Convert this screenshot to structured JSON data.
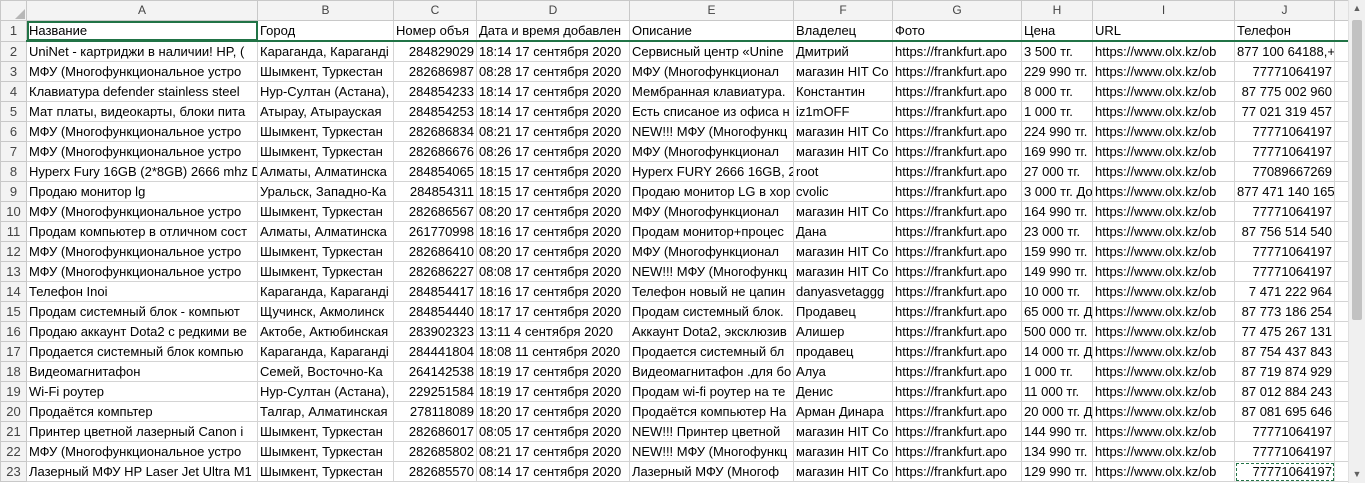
{
  "columns": [
    "A",
    "B",
    "C",
    "D",
    "E",
    "F",
    "G",
    "H",
    "I",
    "J"
  ],
  "header_row": [
    "Название",
    "Город",
    "Номер объя",
    "Дата и время добавлен",
    "Описание",
    "Владелец",
    "Фото",
    "Цена",
    "URL",
    "Телефон"
  ],
  "rows": [
    {
      "n": "2",
      "cells": [
        "UniNet - картриджи в наличии! HP, (",
        "Караганда, Караганді",
        "284829029",
        "18:14 17 сентября 2020",
        "Сервисный центр «Unine",
        "Дмитрий",
        "https://frankfurt.apo",
        "3 500 тг.",
        "https://www.olx.kz/ob",
        "877 100 64188,+7 ("
      ]
    },
    {
      "n": "3",
      "cells": [
        "МФУ (Многофункциональное устро",
        "Шымкент, Туркестан",
        "282686987",
        "08:28 17 сентября 2020",
        "МФУ (Многофункционал",
        "магазин HIT Co",
        "https://frankfurt.apo",
        "229 990 тг.",
        "https://www.olx.kz/ob",
        "77771064197"
      ]
    },
    {
      "n": "4",
      "cells": [
        "Клавиатура defender stainless steel",
        "Нур-Султан (Астана),",
        "284854233",
        "18:14 17 сентября 2020",
        "Мембранная клавиатура.",
        "Константин",
        "https://frankfurt.apo",
        "8 000 тг.",
        "https://www.olx.kz/ob",
        "87 775 002 960"
      ]
    },
    {
      "n": "5",
      "cells": [
        "Мат платы, видеокарты, блоки пита",
        "Атырау, Атырауская",
        "284854253",
        "18:14 17 сентября 2020",
        "Есть списаное из офиса н",
        "iz1mOFF",
        "https://frankfurt.apo",
        "1 000 тг.",
        "https://www.olx.kz/ob",
        "77 021 319 457"
      ]
    },
    {
      "n": "6",
      "cells": [
        "МФУ (Многофункциональное устро",
        "Шымкент, Туркестан",
        "282686834",
        "08:21 17 сентября 2020",
        "NEW!!! МФУ (Многофункц",
        "магазин HIT Co",
        "https://frankfurt.apo",
        "224 990 тг.",
        "https://www.olx.kz/ob",
        "77771064197"
      ]
    },
    {
      "n": "7",
      "cells": [
        "МФУ (Многофункциональное устро",
        "Шымкент, Туркестан",
        "282686676",
        "08:26 17 сентября 2020",
        "МФУ (Многофункционал",
        "магазин HIT Co",
        "https://frankfurt.apo",
        "169 990 тг.",
        "https://www.olx.kz/ob",
        "77771064197"
      ]
    },
    {
      "n": "8",
      "cells": [
        "Hyperx Fury 16GB (2*8GB) 2666 mhz D",
        "Алматы, Алматинска",
        "284854065",
        "18:15 17 сентября 2020",
        "Hyperx FURY 2666 16GB, 2x",
        "root",
        "https://frankfurt.apo",
        "27 000 тг.",
        "https://www.olx.kz/ob",
        "77089667269"
      ]
    },
    {
      "n": "9",
      "cells": [
        "Продаю монитор lg",
        "Уральск, Западно-Ка",
        "284854311",
        "18:15 17 сентября 2020",
        "Продаю монитор LG в хор",
        "cvolic",
        "https://frankfurt.apo",
        "3 000 тг. До",
        "https://www.olx.kz/ob",
        "877 471 140 165"
      ]
    },
    {
      "n": "10",
      "cells": [
        "МФУ (Многофункциональное устро",
        "Шымкент, Туркестан",
        "282686567",
        "08:20 17 сентября 2020",
        "МФУ (Многофункционал",
        "магазин HIT Co",
        "https://frankfurt.apo",
        "164 990 тг.",
        "https://www.olx.kz/ob",
        "77771064197"
      ]
    },
    {
      "n": "11",
      "cells": [
        "Продам компьютер в отличном сост",
        "Алматы, Алматинска",
        "261770998",
        "18:16 17 сентября 2020",
        "Продам монитор+процес",
        "Дана",
        "https://frankfurt.apo",
        "23 000 тг.",
        "https://www.olx.kz/ob",
        "87 756 514 540"
      ]
    },
    {
      "n": "12",
      "cells": [
        "МФУ (Многофункциональное устро",
        "Шымкент, Туркестан",
        "282686410",
        "08:20 17 сентября 2020",
        "МФУ (Многофункционал",
        "магазин HIT Co",
        "https://frankfurt.apo",
        "159 990 тг.",
        "https://www.olx.kz/ob",
        "77771064197"
      ]
    },
    {
      "n": "13",
      "cells": [
        "МФУ (Многофункциональное устро",
        "Шымкент, Туркестан",
        "282686227",
        "08:08 17 сентября 2020",
        "NEW!!! МФУ (Многофункц",
        "магазин HIT Co",
        "https://frankfurt.apo",
        "149 990 тг.",
        "https://www.olx.kz/ob",
        "77771064197"
      ]
    },
    {
      "n": "14",
      "cells": [
        "Телефон Inoi",
        "Караганда, Караганді",
        "284854417",
        "18:16 17 сентября 2020",
        "Телефон новый не цапин",
        "danyasvetaggg",
        "https://frankfurt.apo",
        "10 000 тг.",
        "https://www.olx.kz/ob",
        "7 471 222 964"
      ]
    },
    {
      "n": "15",
      "cells": [
        "Продам системный блок - компьют",
        "Щучинск, Акмолинск",
        "284854440",
        "18:17 17 сентября 2020",
        "Продам системный блок.",
        "Продавец",
        "https://frankfurt.apo",
        "65 000 тг. Д",
        "https://www.olx.kz/ob",
        "87 773 186 254"
      ]
    },
    {
      "n": "16",
      "cells": [
        "Продаю аккаунт Dota2 с редкими ве",
        "Актобе, Актюбинская",
        "283902323",
        "13:11 4 сентября 2020",
        "Аккаунт Dota2, эксклюзив",
        "Алишер",
        "https://frankfurt.apo",
        "500 000 тг. ,",
        "https://www.olx.kz/ob",
        "77 475 267 131"
      ]
    },
    {
      "n": "17",
      "cells": [
        "Продается системный блок компью",
        "Караганда, Караганді",
        "284441804",
        "18:08 11 сентября 2020",
        "Продается системный бл",
        "продавец",
        "https://frankfurt.apo",
        "14 000 тг. Д",
        "https://www.olx.kz/ob",
        "87 754 437 843"
      ]
    },
    {
      "n": "18",
      "cells": [
        "Видеомагнитафон",
        "Семей, Восточно-Ка",
        "264142538",
        "18:19 17 сентября 2020",
        "Видеомагнитафон .для бо",
        "Алуа",
        "https://frankfurt.apo",
        "1 000 тг.",
        "https://www.olx.kz/ob",
        "87 719 874 929"
      ]
    },
    {
      "n": "19",
      "cells": [
        "Wi-Fi роутер",
        "Нур-Султан (Астана),",
        "229251584",
        "18:19 17 сентября 2020",
        "Продам wi-fi роутер на те",
        "Денис",
        "https://frankfurt.apo",
        "11 000 тг.",
        "https://www.olx.kz/ob",
        "87 012 884 243"
      ]
    },
    {
      "n": "20",
      "cells": [
        "Продаётся компьтер",
        "Талгар, Алматинская",
        "278118089",
        "18:20 17 сентября 2020",
        "Продаётся компьютер На",
        "Арман Динара",
        "https://frankfurt.apo",
        "20 000 тг. Д",
        "https://www.olx.kz/ob",
        "87 081 695 646"
      ]
    },
    {
      "n": "21",
      "cells": [
        "Принтер цветной лазерный Canon i",
        "Шымкент, Туркестан",
        "282686017",
        "08:05 17 сентября 2020",
        "NEW!!! Принтер цветной",
        "магазин HIT Co",
        "https://frankfurt.apo",
        "144 990 тг.",
        "https://www.olx.kz/ob",
        "77771064197"
      ]
    },
    {
      "n": "22",
      "cells": [
        "МФУ (Многофункциональное устро",
        "Шымкент, Туркестан",
        "282685802",
        "08:21 17 сентября 2020",
        "NEW!!! МФУ (Многофункц",
        "магазин HIT Co",
        "https://frankfurt.apo",
        "134 990 тг.",
        "https://www.olx.kz/ob",
        "77771064197"
      ]
    },
    {
      "n": "23",
      "cells": [
        "Лазерный МФУ HP Laser Jet Ultra M1",
        "Шымкент, Туркестан",
        "282685570",
        "08:14 17 сентября 2020",
        "Лазерный МФУ (Многоф",
        "магазин HIT Co",
        "https://frankfurt.apo",
        "129 990 тг.",
        "https://www.olx.kz/ob",
        "77771064197"
      ]
    }
  ]
}
